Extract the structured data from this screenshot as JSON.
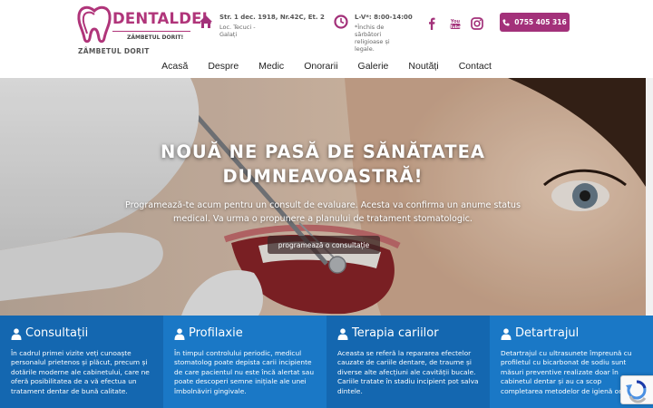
{
  "brand": {
    "name": "DENTALDEL",
    "tagline": "ZÂMBETUL DORIT!",
    "slogan": "ZÂMBETUL DORIT",
    "color": "#b0357a"
  },
  "address": {
    "line1": "Str. 1 dec. 1918, Nr.42C, Et. 2",
    "line2": "Loc. Tecuci -",
    "line3": "Galați"
  },
  "hours": {
    "line1": "L-V*: 8:00-14:00",
    "line2": "*Închis de",
    "line3": "sărbători",
    "line4": "religioase și",
    "line5": "legale."
  },
  "social": [
    "facebook-icon",
    "youtube-icon",
    "instagram-icon"
  ],
  "call_button": {
    "label": "0755 405 316"
  },
  "nav": {
    "items": [
      "Acasă",
      "Despre",
      "Medic",
      "Onorarii",
      "Galerie",
      "Noutăți",
      "Contact"
    ]
  },
  "hero": {
    "title_line1": "NOUĂ NE PASĂ DE SĂNĂTATEA",
    "title_line2": "DUMNEAVOASTRĂ!",
    "subtitle": "Programează-te acum pentru un consult de evaluare. Acesta va confirma un anume status medical. Va urma o propunere a planului de tratament stomatologic.",
    "button": "programează o consultație"
  },
  "services": [
    {
      "title": "Consultații",
      "color": "#1467b0",
      "text": "În cadrul primei vizite veți cunoaște personalul prietenos și plăcut, precum și dotările moderne ale cabinetului, care ne oferă posibilitatea de a vă efectua un tratament dentar de bună calitate."
    },
    {
      "title": "Profilaxie",
      "color": "#1a78c6",
      "text": "În timpul controlului periodic, medicul stomatolog poate depista carii incipiente de care pacientul nu este încă alertat sau poate descoperi semne inițiale ale unei îmbolnăviri gingivale."
    },
    {
      "title": "Terapia cariilor",
      "color": "#1467b0",
      "text": "Aceasta se referă la repararea efectelor cauzate de cariile dentare, de traume și diverse alte afecțiuni ale cavității bucale. Cariile tratate în stadiu incipient pot salva dintele."
    },
    {
      "title": "Detartrajul",
      "color": "#1a78c6",
      "text": "Detartrajul cu ultrasunete împreună cu profiletul cu bicarbonat de sodiu sunt măsuri preventive realizate doar în cabinetul dentar și au ca scop completarea metodelor de igienă orală."
    }
  ]
}
